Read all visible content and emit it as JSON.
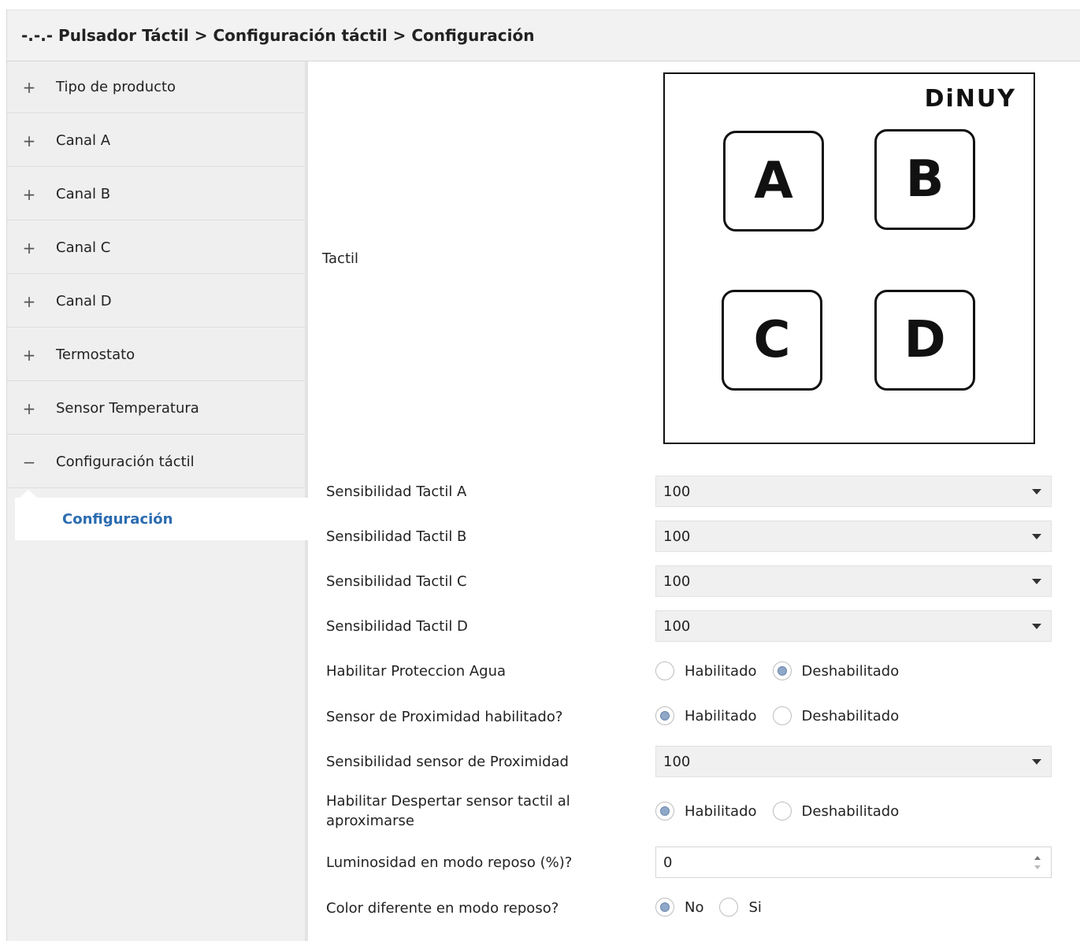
{
  "title": "-.-.- Pulsador Táctil > Configuración táctil > Configuración",
  "sidebar": {
    "items": [
      {
        "sign": "+",
        "label": "Tipo de producto"
      },
      {
        "sign": "+",
        "label": "Canal A"
      },
      {
        "sign": "+",
        "label": "Canal B"
      },
      {
        "sign": "+",
        "label": "Canal C"
      },
      {
        "sign": "+",
        "label": "Canal D"
      },
      {
        "sign": "+",
        "label": "Termostato"
      },
      {
        "sign": "+",
        "label": "Sensor Temperatura"
      },
      {
        "sign": "−",
        "label": "Configuración táctil"
      }
    ],
    "subitem": "Configuración"
  },
  "main": {
    "tactil_label": "Tactil",
    "device": {
      "logo": "DiNUY",
      "keys": [
        "A",
        "B",
        "C",
        "D"
      ]
    },
    "params": [
      {
        "label": "Sensibilidad Tactil A",
        "type": "select",
        "value": "100"
      },
      {
        "label": "Sensibilidad Tactil B",
        "type": "select",
        "value": "100"
      },
      {
        "label": "Sensibilidad Tactil C",
        "type": "select",
        "value": "100"
      },
      {
        "label": "Sensibilidad Tactil D",
        "type": "select",
        "value": "100"
      },
      {
        "label": "Habilitar Proteccion Agua",
        "type": "radio",
        "options": [
          "Habilitado",
          "Deshabilitado"
        ],
        "selected": "Deshabilitado"
      },
      {
        "label": "Sensor de Proximidad habilitado?",
        "type": "radio",
        "options": [
          "Habilitado",
          "Deshabilitado"
        ],
        "selected": "Habilitado"
      },
      {
        "label": "Sensibilidad sensor de Proximidad",
        "type": "select",
        "value": "100"
      },
      {
        "label_line1": "Habilitar Despertar sensor tactil al",
        "label_line2": "aproximarse",
        "type": "radio",
        "options": [
          "Habilitado",
          "Deshabilitado"
        ],
        "selected": "Habilitado"
      },
      {
        "label": "Luminosidad en modo reposo (%)?",
        "type": "spin",
        "value": "0"
      },
      {
        "label": "Color diferente en modo reposo?",
        "type": "radio",
        "options": [
          "No",
          "Si"
        ],
        "selected": "No"
      }
    ]
  }
}
